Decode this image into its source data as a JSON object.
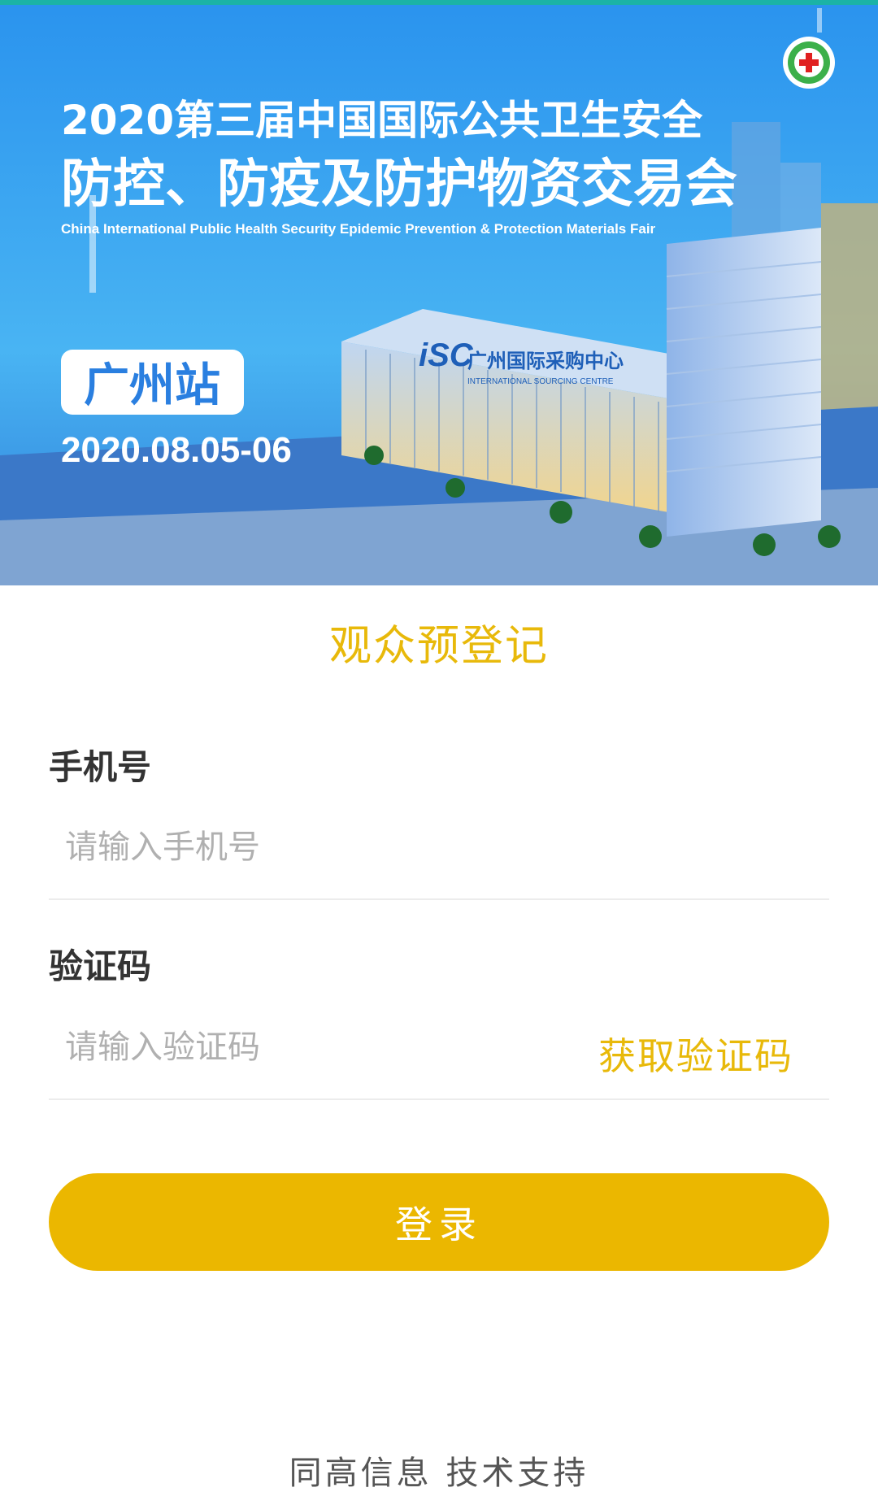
{
  "banner": {
    "title_line1": "2020第三届中国国际公共卫生安全",
    "title_line2": "防控、防疫及防护物资交易会",
    "title_en": "China International Public Health Security Epidemic Prevention & Protection Materials Fair",
    "station": "广州站",
    "date": "2020.08.05-06",
    "venue_logo": "iSC",
    "venue_name": "广州国际采购中心",
    "venue_name_en": "INTERNATIONAL SOURCING CENTRE",
    "colors": {
      "sky_top": "#2A9AF0",
      "sky_bottom": "#5CC3F5",
      "accent_line": "#1BB3A6"
    }
  },
  "form": {
    "title": "观众预登记",
    "phone_label": "手机号",
    "phone_placeholder": "请输入手机号",
    "code_label": "验证码",
    "code_placeholder": "请输入验证码",
    "get_code_label": "获取验证码",
    "login_label": "登录"
  },
  "footer": {
    "text": "同高信息  技术支持"
  },
  "colors": {
    "accent": "#EBB700",
    "label": "#333333",
    "placeholder": "#B0B0B0"
  }
}
